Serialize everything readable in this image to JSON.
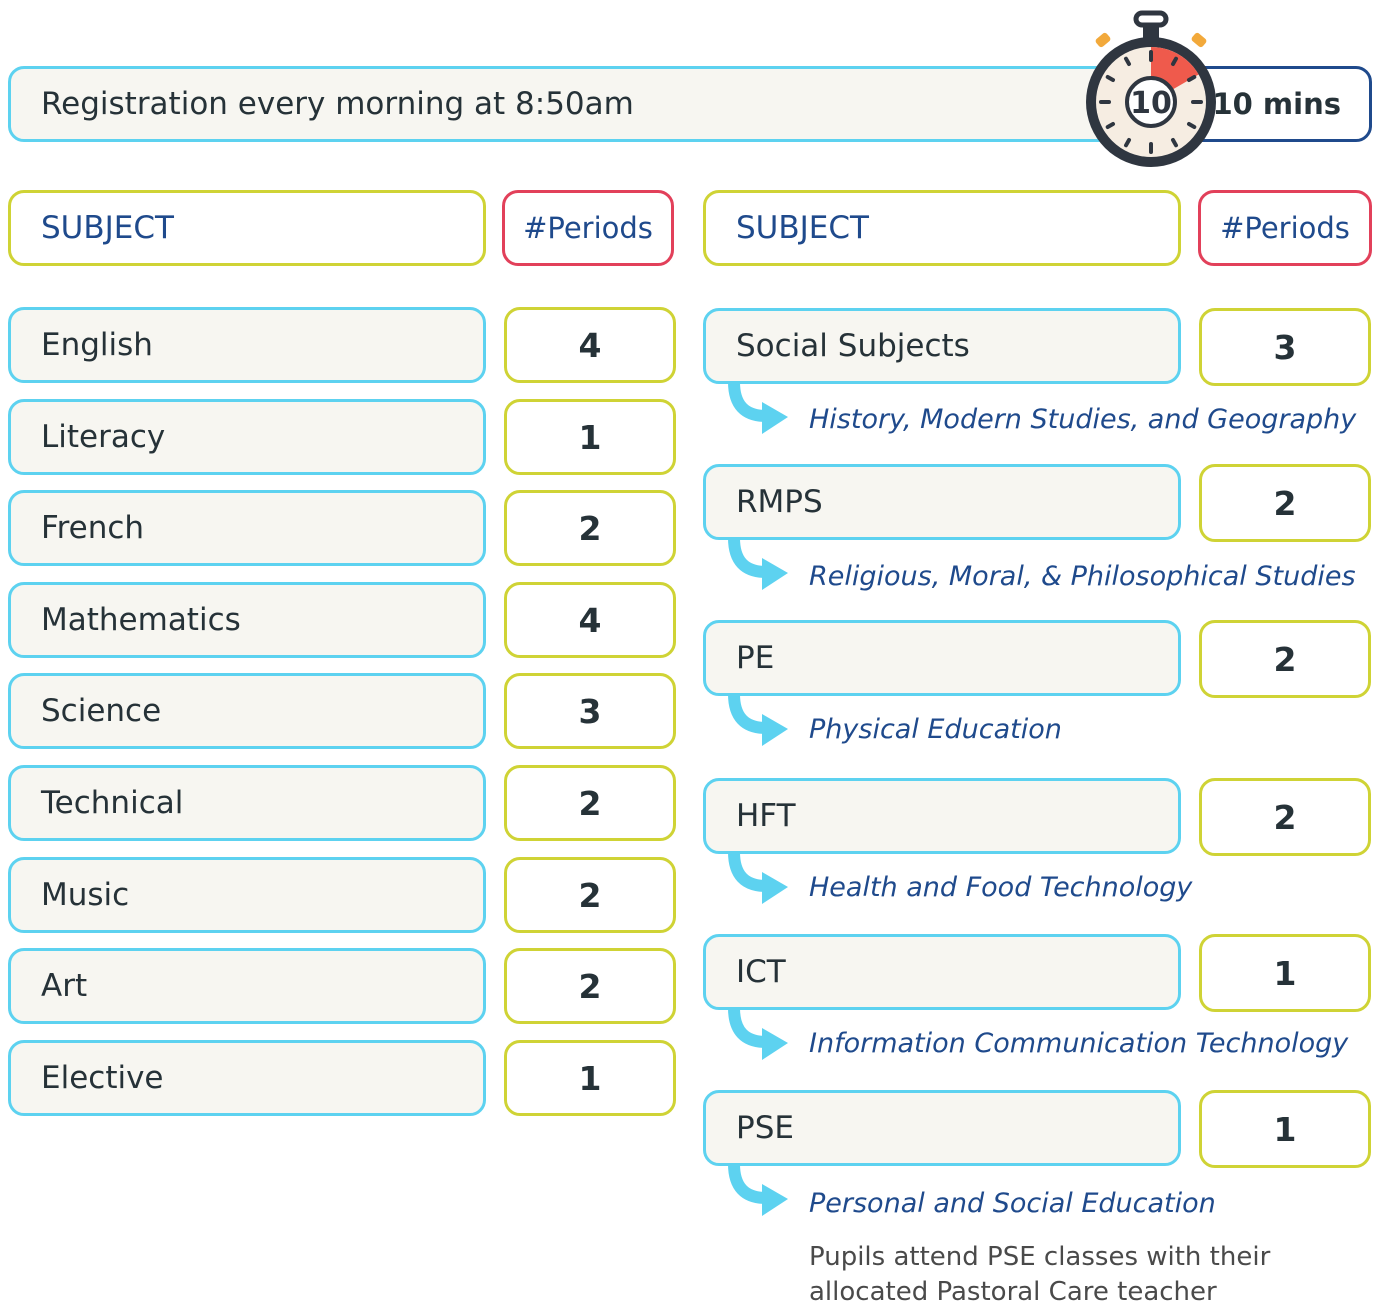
{
  "registration": {
    "text": "Registration every morning at 8:50am",
    "timer_value": "10",
    "duration": "10 mins"
  },
  "headers": {
    "subject": "SUBJECT",
    "periods": "#Periods"
  },
  "left_subjects": [
    {
      "name": "English",
      "periods": "4"
    },
    {
      "name": "Literacy",
      "periods": "1"
    },
    {
      "name": "French",
      "periods": "2"
    },
    {
      "name": "Mathematics",
      "periods": "4"
    },
    {
      "name": "Science",
      "periods": "3"
    },
    {
      "name": "Technical",
      "periods": "2"
    },
    {
      "name": "Music",
      "periods": "2"
    },
    {
      "name": "Art",
      "periods": "2"
    },
    {
      "name": "Elective",
      "periods": "1"
    }
  ],
  "right_subjects": [
    {
      "name": "Social Subjects",
      "periods": "3",
      "description": "History, Modern Studies, and Geography"
    },
    {
      "name": "RMPS",
      "periods": "2",
      "description": "Religious, Moral, & Philosophical Studies"
    },
    {
      "name": "PE",
      "periods": "2",
      "description": "Physical Education"
    },
    {
      "name": "HFT",
      "periods": "2",
      "description": "Health and Food Technology"
    },
    {
      "name": "ICT",
      "periods": "1",
      "description": "Information Communication Technology"
    },
    {
      "name": "PSE",
      "periods": "1",
      "description": "Personal and Social Education"
    }
  ],
  "note": "Pupils attend PSE classes with their allocated Pastoral Care teacher",
  "colors": {
    "subject_border": "#5dd2f0",
    "period_border": "#cfd335",
    "header_period_border": "#e2405a",
    "accent_text": "#1f4a8c",
    "timer_red": "#ef5a4c"
  },
  "icons": {
    "timer": "stopwatch-icon",
    "arrow": "curved-arrow-icon"
  }
}
